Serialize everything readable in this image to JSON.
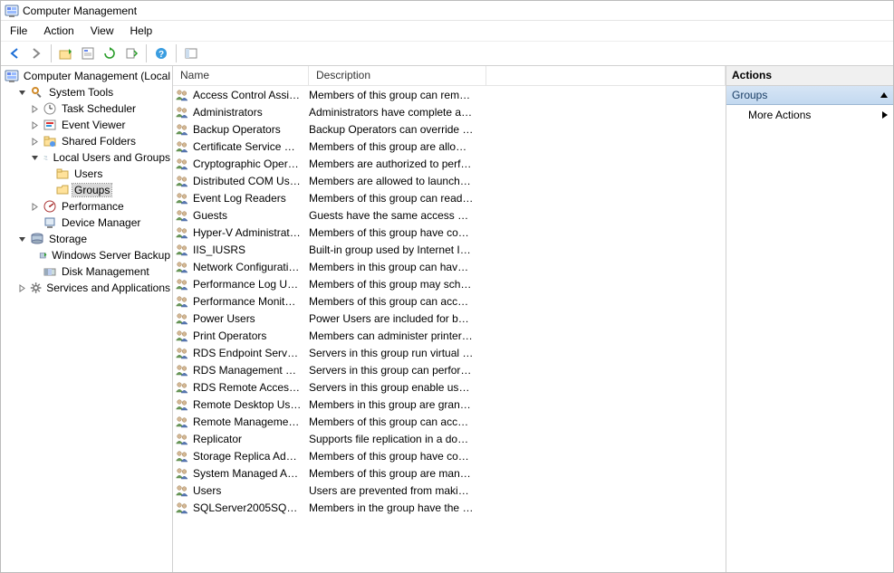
{
  "title": "Computer Management",
  "menu": {
    "file": "File",
    "action": "Action",
    "view": "View",
    "help": "Help"
  },
  "tree": {
    "root": "Computer Management (Local",
    "system_tools": "System Tools",
    "task_scheduler": "Task Scheduler",
    "event_viewer": "Event Viewer",
    "shared_folders": "Shared Folders",
    "local_users": "Local Users and Groups",
    "users": "Users",
    "groups": "Groups",
    "performance": "Performance",
    "device_manager": "Device Manager",
    "storage": "Storage",
    "server_backup": "Windows Server Backup",
    "disk_mgmt": "Disk Management",
    "services_apps": "Services and Applications"
  },
  "columns": {
    "name": "Name",
    "desc": "Description"
  },
  "groups": [
    {
      "name": "Access Control Assist...",
      "desc": "Members of this group can remot..."
    },
    {
      "name": "Administrators",
      "desc": "Administrators have complete an..."
    },
    {
      "name": "Backup Operators",
      "desc": "Backup Operators can override se..."
    },
    {
      "name": "Certificate Service DC...",
      "desc": "Members of this group are allowe..."
    },
    {
      "name": "Cryptographic Operat...",
      "desc": "Members are authorized to perfor..."
    },
    {
      "name": "Distributed COM Users",
      "desc": "Members are allowed to launch, a..."
    },
    {
      "name": "Event Log Readers",
      "desc": "Members of this group can read e..."
    },
    {
      "name": "Guests",
      "desc": "Guests have the same access as m..."
    },
    {
      "name": "Hyper-V Administrators",
      "desc": "Members of this group have com..."
    },
    {
      "name": "IIS_IUSRS",
      "desc": "Built-in group used by Internet Inf..."
    },
    {
      "name": "Network Configuratio...",
      "desc": "Members in this group can have s..."
    },
    {
      "name": "Performance Log Users",
      "desc": "Members of this group may sche..."
    },
    {
      "name": "Performance Monitor ...",
      "desc": "Members of this group can acces..."
    },
    {
      "name": "Power Users",
      "desc": "Power Users are included for back..."
    },
    {
      "name": "Print Operators",
      "desc": "Members can administer printers ..."
    },
    {
      "name": "RDS Endpoint Servers",
      "desc": "Servers in this group run virtual m..."
    },
    {
      "name": "RDS Management Ser...",
      "desc": "Servers in this group can perform ..."
    },
    {
      "name": "RDS Remote Access S...",
      "desc": "Servers in this group enable users ..."
    },
    {
      "name": "Remote Desktop Users",
      "desc": "Members in this group are grante..."
    },
    {
      "name": "Remote Management...",
      "desc": "Members of this group can acces..."
    },
    {
      "name": "Replicator",
      "desc": "Supports file replication in a dom..."
    },
    {
      "name": "Storage Replica Admi...",
      "desc": "Members of this group have com..."
    },
    {
      "name": "System Managed Acc...",
      "desc": "Members of this group are mana..."
    },
    {
      "name": "Users",
      "desc": "Users are prevented from making ..."
    },
    {
      "name": "SQLServer2005SQLBro...",
      "desc": "Members in the group have the re..."
    }
  ],
  "actions": {
    "header": "Actions",
    "group_label": "Groups",
    "more": "More Actions"
  }
}
